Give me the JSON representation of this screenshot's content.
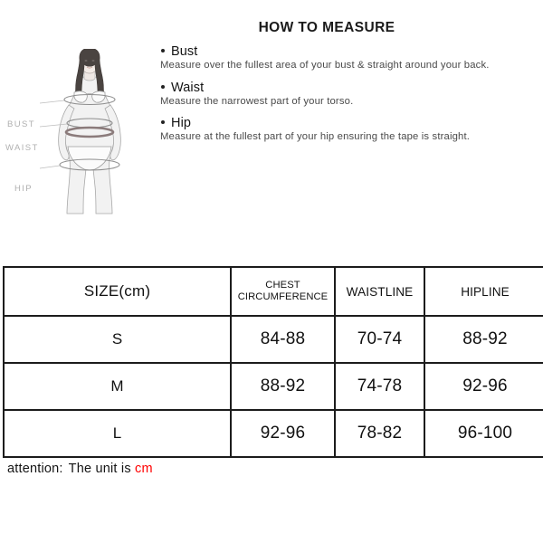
{
  "figure": {
    "alt_name": "female-body-measurement-diagram",
    "labels": [
      {
        "key": "bust",
        "text": "BUST"
      },
      {
        "key": "waist",
        "text": "WAIST"
      },
      {
        "key": "hip",
        "text": "HIP"
      }
    ],
    "label_color": "#b0b0b0",
    "line_color": "#9a9a9a"
  },
  "measure": {
    "title": "HOW TO MEASURE",
    "items": [
      {
        "label": "Bust",
        "description": "Measure over the fullest area of your bust & straight around your back."
      },
      {
        "label": "Waist",
        "description": "Measure the narrowest part of your torso."
      },
      {
        "label": "Hip",
        "description": "Measure at the fullest part of your hip ensuring the tape is straight."
      }
    ]
  },
  "chart_data": {
    "type": "table",
    "title": "SIZE(cm)",
    "columns": [
      "SIZE(cm)",
      "CHEST CIRCUMFERENCE",
      "WAISTLINE",
      "HIPLINE"
    ],
    "column_labels_multiline": [
      [
        "SIZE(cm)"
      ],
      [
        "CHEST",
        "CIRCUMFERENCE"
      ],
      [
        "WAISTLINE"
      ],
      [
        "HIPLINE"
      ]
    ],
    "unit": "cm",
    "rows": [
      {
        "size": "S",
        "chest": "84-88",
        "waist": "70-74",
        "hip": "88-92"
      },
      {
        "size": "M",
        "chest": "88-92",
        "waist": "74-78",
        "hip": "92-96"
      },
      {
        "size": "L",
        "chest": "92-96",
        "waist": "78-82",
        "hip": "96-100"
      }
    ]
  },
  "footer": {
    "prefix": "attention:",
    "text": "The unit is",
    "unit": "cm",
    "unit_color": "#ff0000"
  }
}
